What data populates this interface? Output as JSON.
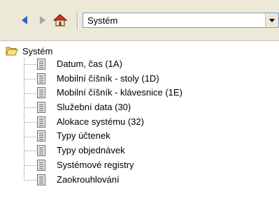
{
  "toolbar": {
    "back_icon": "back-arrow-icon",
    "forward_icon": "forward-arrow-icon",
    "home_icon": "home-icon",
    "location_value": "Systém"
  },
  "tree": {
    "root_label": "Systém",
    "items": [
      {
        "label": "Datum, čas (1A)"
      },
      {
        "label": "Mobilní číšník - stoly (1D)"
      },
      {
        "label": "Mobilní číšník - klávesnice (1E)"
      },
      {
        "label": "Služební data (30)"
      },
      {
        "label": "Alokace systému (32)"
      },
      {
        "label": "Typy účtenek"
      },
      {
        "label": "Typy objednávek"
      },
      {
        "label": "Systémové registry"
      },
      {
        "label": "Zaokrouhlování"
      }
    ]
  },
  "colors": {
    "toolbar_bg": "#ece9d8",
    "arrow_blue": "#2a63c8",
    "folder_yellow": "#f5d36a"
  }
}
